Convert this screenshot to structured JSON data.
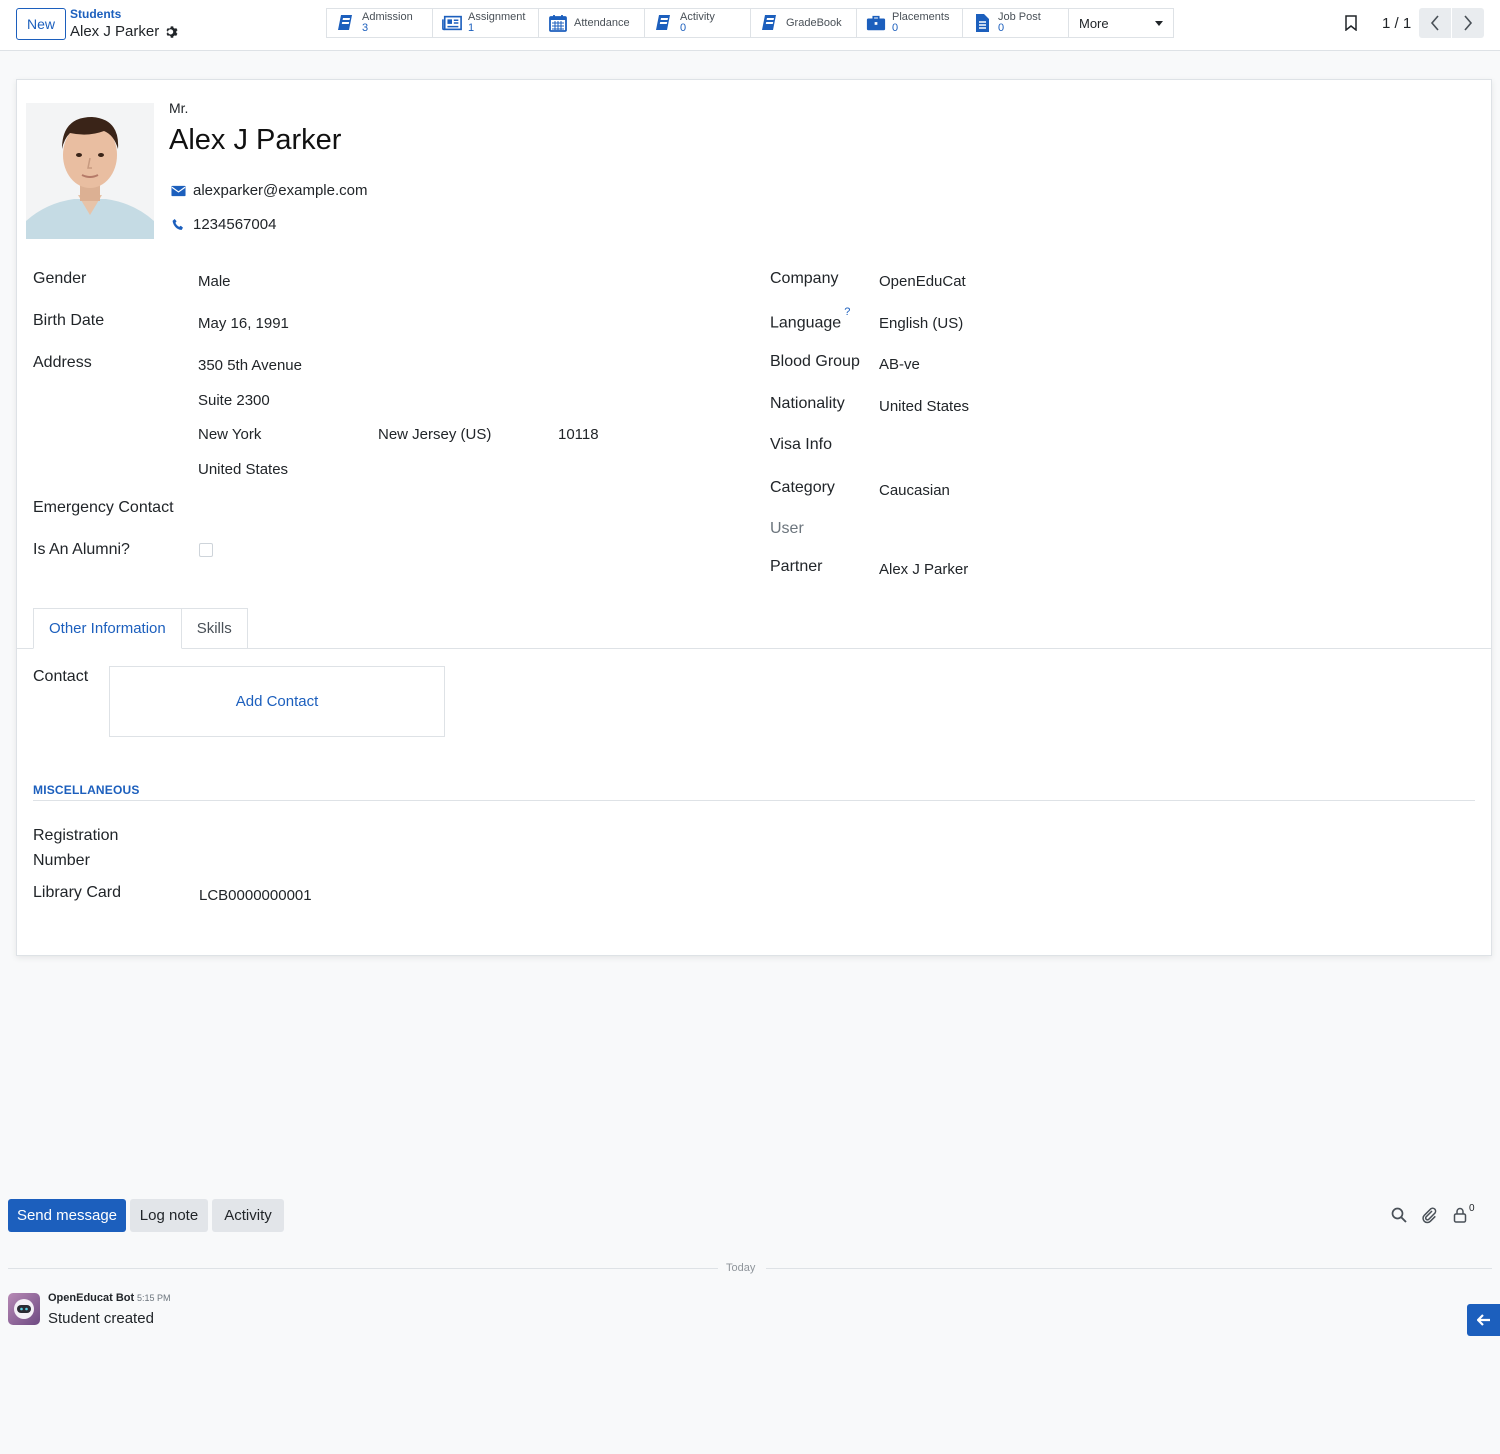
{
  "control_panel": {
    "new_label": "New",
    "breadcrumb_parent": "Students",
    "breadcrumb_current": "Alex J Parker",
    "smart_buttons": [
      {
        "label": "Admission",
        "count": "3",
        "icon": "book-icon"
      },
      {
        "label": "Assignment",
        "count": "1",
        "icon": "newspaper-icon"
      },
      {
        "label": "Attendance",
        "count": "",
        "icon": "calendar-icon"
      },
      {
        "label": "Activity",
        "count": "0",
        "icon": "book-icon"
      },
      {
        "label": "GradeBook",
        "count": "",
        "icon": "book-icon"
      },
      {
        "label": "Placements",
        "count": "0",
        "icon": "briefcase-icon"
      },
      {
        "label": "Job Post",
        "count": "0",
        "icon": "document-icon"
      }
    ],
    "more_label": "More",
    "pager_value": "1 / 1"
  },
  "student": {
    "title": "Mr.",
    "name": "Alex J Parker",
    "email": "alexparker@example.com",
    "phone": "1234567004"
  },
  "left_fields": {
    "gender_label": "Gender",
    "gender": "Male",
    "birth_date_label": "Birth Date",
    "birth_date": "May 16, 1991",
    "address_label": "Address",
    "street": "350 5th Avenue",
    "street2": "Suite 2300",
    "city": "New York",
    "state": "New Jersey (US)",
    "zip": "10118",
    "country": "United States",
    "emergency_contact_label": "Emergency Contact",
    "is_alumni_label": "Is An Alumni?",
    "is_alumni": false
  },
  "right_fields": {
    "company_label": "Company",
    "company": "OpenEduCat",
    "language_label": "Language",
    "language_help": "?",
    "language": "English (US)",
    "blood_group_label": "Blood Group",
    "blood_group": "AB-ve",
    "nationality_label": "Nationality",
    "nationality": "United States",
    "visa_info_label": "Visa Info",
    "category_label": "Category",
    "category": "Caucasian",
    "user_label": "User",
    "partner_label": "Partner",
    "partner": "Alex J Parker"
  },
  "tabs": [
    {
      "label": "Other Information",
      "active": true
    },
    {
      "label": "Skills",
      "active": false
    }
  ],
  "other_info": {
    "contact_label": "Contact",
    "add_contact_label": "Add Contact",
    "misc_title": "MISCELLANEOUS",
    "registration_number_label_line1": "Registration",
    "registration_number_label_line2": "Number",
    "library_card_label": "Library Card",
    "library_card": "LCB0000000001"
  },
  "chatter": {
    "send_message_label": "Send message",
    "log_note_label": "Log note",
    "activity_label": "Activity",
    "follower_count": "0",
    "date_separator": "Today",
    "messages": [
      {
        "author": "OpenEducat Bot",
        "time": "5:15 PM",
        "body": "Student created"
      }
    ]
  },
  "colors": {
    "primary": "#1c5fbd",
    "background": "#f8f9fa",
    "border": "#dee2e6"
  }
}
